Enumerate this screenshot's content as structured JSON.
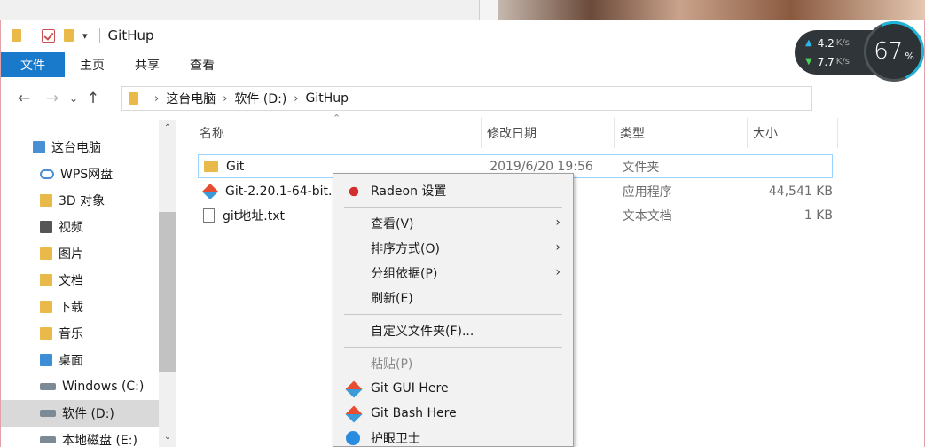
{
  "window": {
    "title": "GitHup"
  },
  "ribbon": {
    "tabs": [
      "文件",
      "主页",
      "共享",
      "查看"
    ]
  },
  "address": {
    "crumbs": [
      "这台电脑",
      "软件 (D:)",
      "GitHup"
    ]
  },
  "net_widget": {
    "upload": "4.2",
    "upload_unit": "K/s",
    "download": "7.7",
    "download_unit": "K/s",
    "usage": "67",
    "usage_unit": "%"
  },
  "sidebar": {
    "items": [
      {
        "label": "这台电脑",
        "icon": "computer-icon",
        "color": "#4a8fd6"
      },
      {
        "label": "WPS网盘",
        "icon": "cloud-icon",
        "color": "#4a8fd6"
      },
      {
        "label": "3D 对象",
        "icon": "3d-objects-icon",
        "color": "#e9b94a"
      },
      {
        "label": "视频",
        "icon": "video-icon",
        "color": "#555555"
      },
      {
        "label": "图片",
        "icon": "pictures-icon",
        "color": "#e9b94a"
      },
      {
        "label": "文档",
        "icon": "documents-icon",
        "color": "#e9b94a"
      },
      {
        "label": "下载",
        "icon": "downloads-icon",
        "color": "#e9b94a"
      },
      {
        "label": "音乐",
        "icon": "music-icon",
        "color": "#e9b94a"
      },
      {
        "label": "桌面",
        "icon": "desktop-icon",
        "color": "#3c8fd6"
      },
      {
        "label": "Windows (C:)",
        "icon": "drive-c-icon",
        "color": "#7c8a96"
      },
      {
        "label": "软件 (D:)",
        "icon": "drive-d-icon",
        "color": "#7c8a96"
      },
      {
        "label": "本地磁盘 (E:)",
        "icon": "drive-e-icon",
        "color": "#7c8a96"
      }
    ]
  },
  "columns": [
    "名称",
    "修改日期",
    "类型",
    "大小"
  ],
  "files": [
    {
      "name": "Git",
      "date": "2019/6/20 19:56",
      "type": "文件夹",
      "size": "",
      "icon": "folder-icon"
    },
    {
      "name": "Git-2.20.1-64-bit.",
      "date": ":35",
      "type": "应用程序",
      "size": "44,541 KB",
      "icon": "git-installer-icon"
    },
    {
      "name": "git地址.txt",
      "date": ":35",
      "type": "文本文档",
      "size": "1 KB",
      "icon": "text-file-icon"
    }
  ],
  "context_menu": {
    "items": [
      {
        "label": "Radeon 设置",
        "icon": "radeon-icon"
      },
      {
        "label": "查看(V)",
        "submenu": true
      },
      {
        "label": "排序方式(O)",
        "submenu": true
      },
      {
        "label": "分组依据(P)",
        "submenu": true
      },
      {
        "label": "刷新(E)"
      },
      {
        "label": "自定义文件夹(F)..."
      },
      {
        "label": "粘贴(P)",
        "disabled": true
      },
      {
        "label": "Git GUI Here",
        "icon": "git-gui-icon"
      },
      {
        "label": "Git Bash Here",
        "icon": "git-bash-icon"
      },
      {
        "label": "护眼卫士",
        "icon": "eye-guard-icon"
      }
    ]
  }
}
